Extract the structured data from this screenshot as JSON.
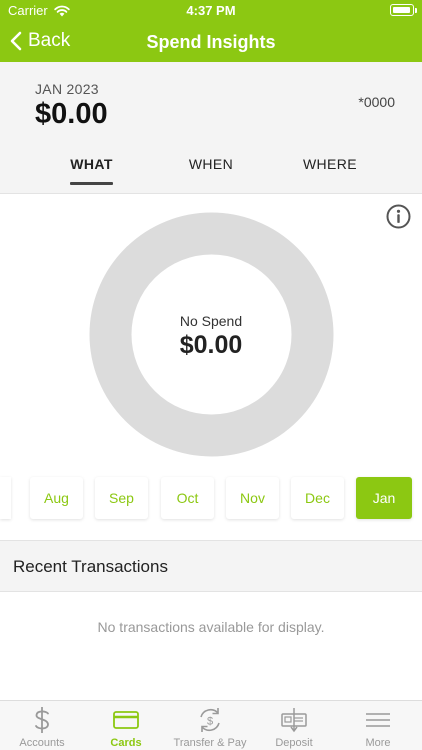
{
  "status_bar": {
    "carrier": "Carrier",
    "time": "4:37 PM"
  },
  "nav": {
    "back_label": "Back",
    "title": "Spend Insights"
  },
  "summary": {
    "period": "JAN 2023",
    "total": "$0.00",
    "account": "*0000"
  },
  "view_tabs": [
    {
      "label": "WHAT",
      "active": true
    },
    {
      "label": "WHEN",
      "active": false
    },
    {
      "label": "WHERE",
      "active": false
    }
  ],
  "donut": {
    "label": "No Spend",
    "value": "$0.00",
    "ring_color": "#dcdcdc"
  },
  "months": [
    {
      "label": "Aug",
      "active": false
    },
    {
      "label": "Sep",
      "active": false
    },
    {
      "label": "Oct",
      "active": false
    },
    {
      "label": "Nov",
      "active": false
    },
    {
      "label": "Dec",
      "active": false
    },
    {
      "label": "Jan",
      "active": true
    }
  ],
  "recent": {
    "title": "Recent Transactions",
    "empty_message": "No transactions available for display."
  },
  "tab_bar": [
    {
      "label": "Accounts",
      "icon": "dollar-icon",
      "active": false
    },
    {
      "label": "Cards",
      "icon": "card-icon",
      "active": true
    },
    {
      "label": "Transfer & Pay",
      "icon": "transfer-pay-icon",
      "active": false
    },
    {
      "label": "Deposit",
      "icon": "check-deposit-icon",
      "active": false
    },
    {
      "label": "More",
      "icon": "hamburger-menu-icon",
      "active": false
    }
  ],
  "colors": {
    "accent": "#8cc812",
    "header_bg": "#f4f4f4",
    "muted_text": "#999999"
  }
}
